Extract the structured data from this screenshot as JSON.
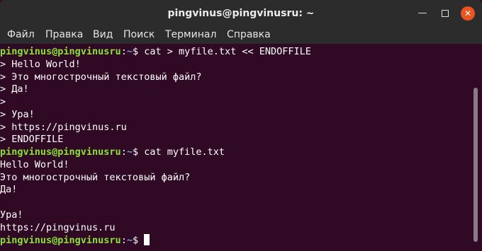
{
  "window": {
    "title": "pingvinus@pingvinusru: ~",
    "minimize_label": "—",
    "close_label": "✕"
  },
  "menu": {
    "items": [
      "Файл",
      "Правка",
      "Вид",
      "Поиск",
      "Терминал",
      "Справка"
    ]
  },
  "prompt": {
    "user_host": "pingvinus@pingvinusru",
    "separator": ":",
    "path": "~",
    "symbol": "$ "
  },
  "terminal": {
    "command1": "cat > myfile.txt << ENDOFFILE",
    "heredoc": [
      "> Hello World!",
      "> Это многострочный текстовый файл?",
      "> Да!",
      ">",
      "> Ура!",
      "> https://pingvinus.ru",
      "> ENDOFFILE"
    ],
    "command2": "cat myfile.txt",
    "output": [
      "Hello World!",
      "Это многострочный текстовый файл?",
      "Да!",
      "",
      "Ура!",
      "https://pingvinus.ru"
    ],
    "command3": ""
  },
  "colors": {
    "background": "#300a24",
    "titlebar": "#2c2c2c",
    "prompt_user": "#8ae234",
    "prompt_path": "#729fcf",
    "close_button": "#e95420"
  }
}
